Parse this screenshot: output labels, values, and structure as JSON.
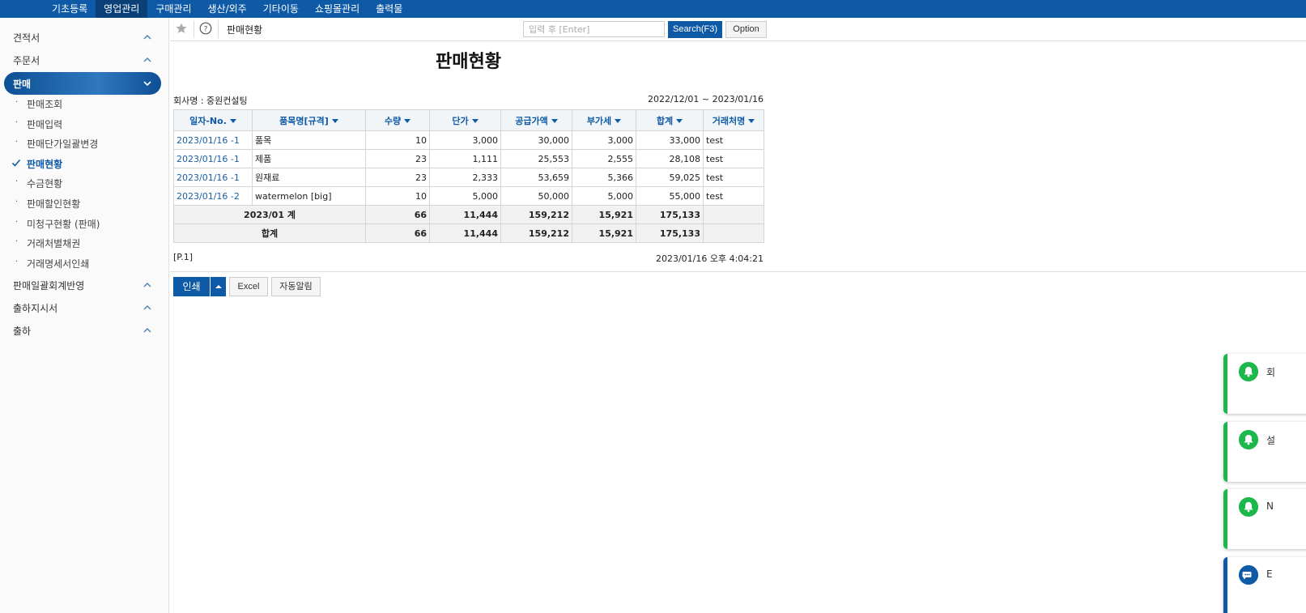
{
  "top_menu": {
    "items": [
      "기초등록",
      "영업관리",
      "구매관리",
      "생산/외주",
      "기타이동",
      "쇼핑몰관리",
      "출력물"
    ],
    "active_index": 1
  },
  "sidebar": {
    "groups_top": [
      "견적서",
      "주문서"
    ],
    "active_group": "판매",
    "sub_items": [
      "판매조회",
      "판매입력",
      "판매단가일괄변경",
      "판매현황",
      "수금현황",
      "판매할인현황",
      "미청구현황 (판매)",
      "거래처별채권",
      "거래명세서인쇄"
    ],
    "current_sub_index": 3,
    "groups_bottom": [
      "판매일괄회계반영",
      "출하지시서",
      "출하"
    ]
  },
  "toolbar": {
    "breadcrumb": "판매현황",
    "search_placeholder": "입력 후 [Enter]",
    "search_label": "Search(F3)",
    "option_label": "Option"
  },
  "report": {
    "title": "판매현황",
    "company": "회사명 : 중원컨설팅",
    "period": "2022/12/01 ~ 2023/01/16",
    "columns": [
      "일자-No.",
      "품목명[규격]",
      "수량",
      "단가",
      "공급가액",
      "부가세",
      "합계",
      "거래처명"
    ],
    "rows": [
      [
        "2023/01/16 -1",
        "품목",
        "10",
        "3,000",
        "30,000",
        "3,000",
        "33,000",
        "test"
      ],
      [
        "2023/01/16 -1",
        "제품",
        "23",
        "1,111",
        "25,553",
        "2,555",
        "28,108",
        "test"
      ],
      [
        "2023/01/16 -1",
        "원재료",
        "23",
        "2,333",
        "53,659",
        "5,366",
        "59,025",
        "test"
      ],
      [
        "2023/01/16 -2",
        "watermelon [big]",
        "10",
        "5,000",
        "50,000",
        "5,000",
        "55,000",
        "test"
      ]
    ],
    "subtotal": [
      "2023/01 계",
      "66",
      "11,444",
      "159,212",
      "15,921",
      "175,133",
      ""
    ],
    "total": [
      "합계",
      "66",
      "11,444",
      "159,212",
      "15,921",
      "175,133",
      ""
    ],
    "page_no": "[P.1]",
    "printed_at": "2023/01/16 오후 4:04:21"
  },
  "actions": {
    "print_label": "인쇄",
    "excel_label": "Excel",
    "auto_notify_label": "자동알림"
  },
  "notifications": [
    {
      "type": "bell",
      "letter": "회"
    },
    {
      "type": "bell",
      "letter": "설"
    },
    {
      "type": "bell",
      "letter": "N"
    },
    {
      "type": "chat",
      "letter": "E"
    }
  ],
  "colors": {
    "brand": "#0e5aa7",
    "notify_green": "#1db84c"
  }
}
